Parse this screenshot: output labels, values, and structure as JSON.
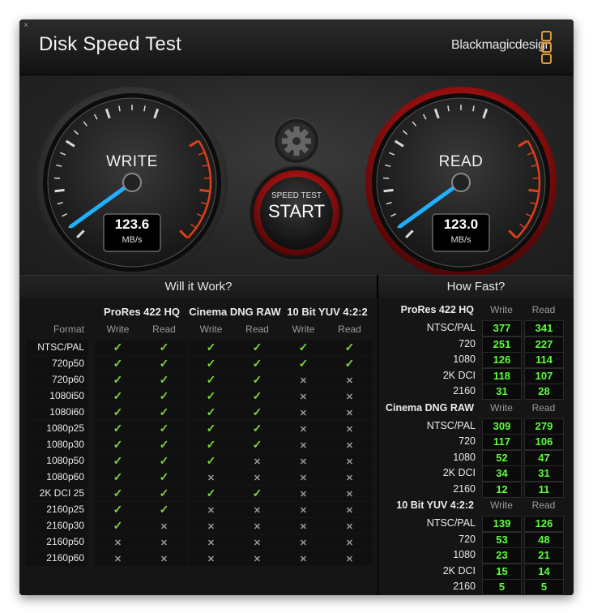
{
  "window": {
    "title": "Disk Speed Test",
    "close_glyph": "×",
    "brand": "Blackmagicdesign",
    "brand_logo_icon": "blackmagic-logo-icon"
  },
  "gauges": {
    "write": {
      "label": "WRITE",
      "value": "123.6",
      "unit": "MB/s"
    },
    "read": {
      "label": "READ",
      "value": "123.0",
      "unit": "MB/s"
    },
    "start_button": {
      "line1": "SPEED TEST",
      "line2": "START"
    },
    "settings_icon": "gear-icon"
  },
  "will_it_work": {
    "title": "Will it Work?",
    "format_header": "Format",
    "groups": [
      "ProRes 422 HQ",
      "Cinema DNG RAW",
      "10 Bit YUV 4:2:2"
    ],
    "subheaders": [
      "Write",
      "Read",
      "Write",
      "Read",
      "Write",
      "Read"
    ],
    "rows": [
      {
        "format": "NTSC/PAL",
        "cells": [
          "yes",
          "yes",
          "yes",
          "yes",
          "yes",
          "yes"
        ]
      },
      {
        "format": "720p50",
        "cells": [
          "yes",
          "yes",
          "yes",
          "yes",
          "yes",
          "yes"
        ]
      },
      {
        "format": "720p60",
        "cells": [
          "yes",
          "yes",
          "yes",
          "yes",
          "no",
          "no"
        ]
      },
      {
        "format": "1080i50",
        "cells": [
          "yes",
          "yes",
          "yes",
          "yes",
          "no",
          "no"
        ]
      },
      {
        "format": "1080i60",
        "cells": [
          "yes",
          "yes",
          "yes",
          "yes",
          "no",
          "no"
        ]
      },
      {
        "format": "1080p25",
        "cells": [
          "yes",
          "yes",
          "yes",
          "yes",
          "no",
          "no"
        ]
      },
      {
        "format": "1080p30",
        "cells": [
          "yes",
          "yes",
          "yes",
          "yes",
          "no",
          "no"
        ]
      },
      {
        "format": "1080p50",
        "cells": [
          "yes",
          "yes",
          "yes",
          "no",
          "no",
          "no"
        ]
      },
      {
        "format": "1080p60",
        "cells": [
          "yes",
          "yes",
          "no",
          "no",
          "no",
          "no"
        ]
      },
      {
        "format": "2K DCI 25",
        "cells": [
          "yes",
          "yes",
          "yes",
          "yes",
          "no",
          "no"
        ]
      },
      {
        "format": "2160p25",
        "cells": [
          "yes",
          "yes",
          "no",
          "no",
          "no",
          "no"
        ]
      },
      {
        "format": "2160p30",
        "cells": [
          "yes",
          "no",
          "no",
          "no",
          "no",
          "no"
        ]
      },
      {
        "format": "2160p50",
        "cells": [
          "no",
          "no",
          "no",
          "no",
          "no",
          "no"
        ]
      },
      {
        "format": "2160p60",
        "cells": [
          "no",
          "no",
          "no",
          "no",
          "no",
          "no"
        ]
      }
    ]
  },
  "how_fast": {
    "title": "How Fast?",
    "write_label": "Write",
    "read_label": "Read",
    "groups": [
      {
        "name": "ProRes 422 HQ",
        "rows": [
          {
            "format": "NTSC/PAL",
            "write": "377",
            "read": "341"
          },
          {
            "format": "720",
            "write": "251",
            "read": "227"
          },
          {
            "format": "1080",
            "write": "126",
            "read": "114"
          },
          {
            "format": "2K DCI",
            "write": "118",
            "read": "107"
          },
          {
            "format": "2160",
            "write": "31",
            "read": "28"
          }
        ]
      },
      {
        "name": "Cinema DNG RAW",
        "rows": [
          {
            "format": "NTSC/PAL",
            "write": "309",
            "read": "279"
          },
          {
            "format": "720",
            "write": "117",
            "read": "106"
          },
          {
            "format": "1080",
            "write": "52",
            "read": "47"
          },
          {
            "format": "2K DCI",
            "write": "34",
            "read": "31"
          },
          {
            "format": "2160",
            "write": "12",
            "read": "11"
          }
        ]
      },
      {
        "name": "10 Bit YUV 4:2:2",
        "rows": [
          {
            "format": "NTSC/PAL",
            "write": "139",
            "read": "126"
          },
          {
            "format": "720",
            "write": "53",
            "read": "48"
          },
          {
            "format": "1080",
            "write": "23",
            "read": "21"
          },
          {
            "format": "2K DCI",
            "write": "15",
            "read": "14"
          },
          {
            "format": "2160",
            "write": "5",
            "read": "5"
          }
        ]
      }
    ]
  },
  "colors": {
    "check": "#7fd63a",
    "value_green": "#5cff3a",
    "needle": "#1fb0ff",
    "read_ring": "#b01a1a",
    "redline": "#e0401a",
    "brand_orange": "#e09a3a"
  }
}
